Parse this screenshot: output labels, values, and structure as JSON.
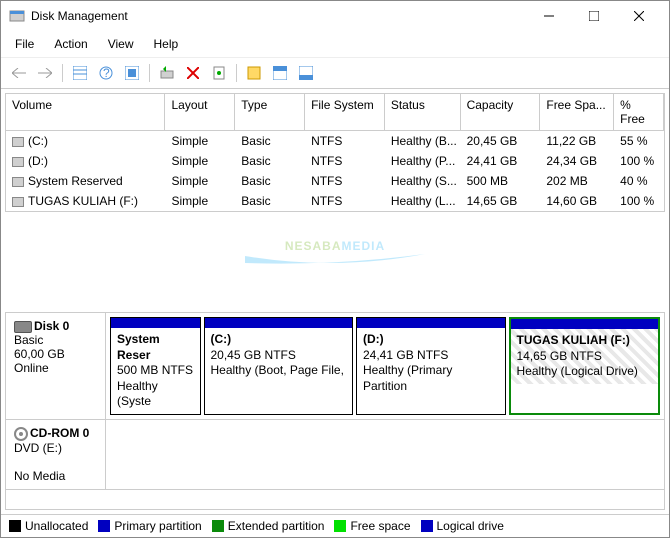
{
  "window": {
    "title": "Disk Management"
  },
  "menu": {
    "file": "File",
    "action": "Action",
    "view": "View",
    "help": "Help"
  },
  "table": {
    "headers": {
      "volume": "Volume",
      "layout": "Layout",
      "type": "Type",
      "fs": "File System",
      "status": "Status",
      "capacity": "Capacity",
      "free": "Free Spa...",
      "pct": "% Free"
    },
    "rows": [
      {
        "vol": "(C:)",
        "layout": "Simple",
        "type": "Basic",
        "fs": "NTFS",
        "status": "Healthy (B...",
        "cap": "20,45 GB",
        "free": "11,22 GB",
        "pct": "55 %"
      },
      {
        "vol": "(D:)",
        "layout": "Simple",
        "type": "Basic",
        "fs": "NTFS",
        "status": "Healthy (P...",
        "cap": "24,41 GB",
        "free": "24,34 GB",
        "pct": "100 %"
      },
      {
        "vol": "System Reserved",
        "layout": "Simple",
        "type": "Basic",
        "fs": "NTFS",
        "status": "Healthy (S...",
        "cap": "500 MB",
        "free": "202 MB",
        "pct": "40 %"
      },
      {
        "vol": "TUGAS KULIAH (F:)",
        "layout": "Simple",
        "type": "Basic",
        "fs": "NTFS",
        "status": "Healthy (L...",
        "cap": "14,65 GB",
        "free": "14,60 GB",
        "pct": "100 %"
      }
    ]
  },
  "watermark": {
    "part1": "NESABA",
    "part2": "MEDIA"
  },
  "disks": {
    "disk0": {
      "name": "Disk 0",
      "type": "Basic",
      "size": "60,00 GB",
      "status": "Online",
      "parts": [
        {
          "name": "System Reser",
          "size": "500 MB NTFS",
          "status": "Healthy (Syste"
        },
        {
          "name": "(C:)",
          "size": "20,45 GB NTFS",
          "status": "Healthy (Boot, Page File,"
        },
        {
          "name": "(D:)",
          "size": "24,41 GB NTFS",
          "status": "Healthy (Primary Partition"
        },
        {
          "name": "TUGAS KULIAH  (F:)",
          "size": "14,65 GB NTFS",
          "status": "Healthy (Logical Drive)"
        }
      ]
    },
    "cdrom": {
      "name": "CD-ROM 0",
      "type": "DVD (E:)",
      "status": "No Media"
    }
  },
  "legend": {
    "unalloc": "Unallocated",
    "primary": "Primary partition",
    "extended": "Extended partition",
    "free": "Free space",
    "logical": "Logical drive"
  },
  "colors": {
    "unalloc": "#000000",
    "primary": "#0000c0",
    "extended": "#0a8a0a",
    "free": "#00e000",
    "logical": "#0000c0"
  }
}
